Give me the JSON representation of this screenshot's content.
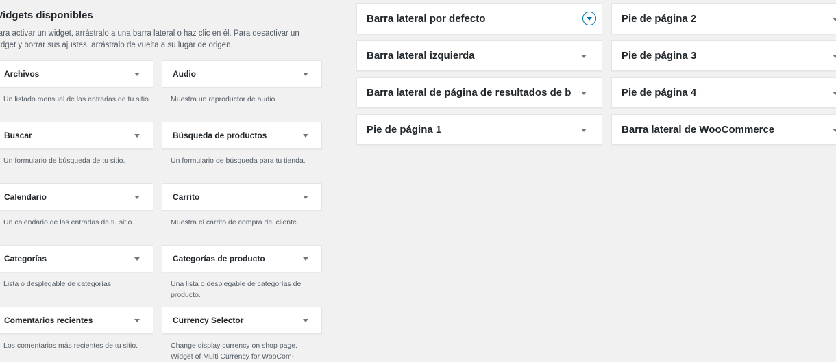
{
  "available": {
    "title": "Widgets disponibles",
    "description": "Para activar un widget, arrástralo a una barra lateral o haz clic en él. Para desactivar un widget y borrar sus ajustes, arrástralo de vuelta a su lugar de origen."
  },
  "widgets": [
    {
      "name": "Archivos",
      "desc": "Un listado mensual de las entradas de tu sitio."
    },
    {
      "name": "Audio",
      "desc": "Muestra un reproductor de audio."
    },
    {
      "name": "Buscar",
      "desc": "Un formulario de búsqueda de tu sitio."
    },
    {
      "name": "Búsqueda de productos",
      "desc": "Un formulario de búsqueda para tu tienda."
    },
    {
      "name": "Calendario",
      "desc": "Un calendario de las entradas de tu sitio."
    },
    {
      "name": "Carrito",
      "desc": "Muestra el carrito de compra del cliente."
    },
    {
      "name": "Categorías",
      "desc": "Lista o desplegable de categorías."
    },
    {
      "name": "Categorías de producto",
      "desc": "Una lista o desplegable de categorías de producto."
    },
    {
      "name": "Comentarios recientes",
      "desc": "Los comentarios más recientes de tu sitio."
    },
    {
      "name": "Currency Selector",
      "desc": "Change display currency on shop page. Widget of Multi Currency for WooCom-"
    }
  ],
  "sidebars_left": [
    "Barra lateral por defecto",
    "Barra lateral izquierda",
    "Barra lateral de página de resultados de búsqueda",
    "Pie de página 1"
  ],
  "sidebars_right": [
    "Pie de página 2",
    "Pie de página 3",
    "Pie de página 4",
    "Barra lateral de WooCommerce"
  ],
  "colors": {
    "accent": "#0073aa",
    "background": "#f1f1f1"
  }
}
